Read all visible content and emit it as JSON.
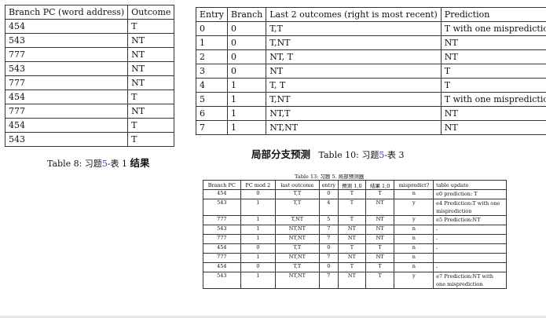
{
  "table8": {
    "headers": [
      "Branch PC (word address)",
      "Outcome"
    ],
    "rows": [
      [
        "454",
        "T"
      ],
      [
        "543",
        "NT"
      ],
      [
        "777",
        "NT"
      ],
      [
        "543",
        "NT"
      ],
      [
        "777",
        "NT"
      ],
      [
        "454",
        "T"
      ],
      [
        "777",
        "NT"
      ],
      [
        "454",
        "T"
      ],
      [
        "543",
        "T"
      ]
    ],
    "caption": {
      "prefix": "Table 8: 习题",
      "ref": "5",
      "suffix": "-表 1",
      "extra": "结果"
    }
  },
  "table10": {
    "headers": [
      "Entry",
      "Branch",
      "Last 2 outcomes (right is most recent)",
      "Prediction"
    ],
    "rows": [
      [
        "0",
        "0",
        "T,T",
        "T with one misprediction"
      ],
      [
        "1",
        "0",
        "T,NT",
        "NT"
      ],
      [
        "2",
        "0",
        "NT, T",
        "NT"
      ],
      [
        "3",
        "0",
        "NT",
        "T"
      ],
      [
        "4",
        "1",
        "T, T",
        "T"
      ],
      [
        "5",
        "1",
        "T,NT",
        "T with one misprediction"
      ],
      [
        "6",
        "1",
        "NT,T",
        "NT"
      ],
      [
        "7",
        "1",
        "NT,NT",
        "NT"
      ]
    ],
    "caption": {
      "extra": "局部分支预测",
      "prefix": "Table 10: 习题",
      "ref": "5",
      "suffix": "-表 3"
    }
  },
  "table13": {
    "caption": "Table 13: 习题 5. 局部预测器",
    "headers": [
      "Branch PC",
      "PC mod 2",
      "last outcome",
      "entry",
      "预测 1,0",
      "结果 1,0",
      "mispredict?",
      "table update"
    ],
    "rows": [
      [
        "454",
        "0",
        "T,T",
        "0",
        "T",
        "T",
        "n",
        "e0 prediction: T"
      ],
      [
        "543",
        "1",
        "T,T",
        "4",
        "T",
        "NT",
        "y",
        "e4 Prediction:T with one misprediction"
      ],
      [
        "777",
        "1",
        "T,NT",
        "5",
        "T",
        "NT",
        "y",
        "e5 Prediction:NT"
      ],
      [
        "543",
        "1",
        "NT,NT",
        "7",
        "NT",
        "NT",
        "n",
        "-"
      ],
      [
        "777",
        "1",
        "NT,NT",
        "7",
        "NT",
        "NT",
        "n",
        "-"
      ],
      [
        "454",
        "0",
        "T,T",
        "0",
        "T",
        "T",
        "n",
        "-"
      ],
      [
        "777",
        "1",
        "NT,NT",
        "7",
        "NT",
        "NT",
        "n",
        ""
      ],
      [
        "454",
        "0",
        "T,T",
        "0",
        "T",
        "T",
        "n",
        "-"
      ],
      [
        "543",
        "1",
        "NT,NT",
        "7",
        "NT",
        "T",
        "y",
        "e7 Prediction:NT with one misprediction"
      ]
    ]
  }
}
